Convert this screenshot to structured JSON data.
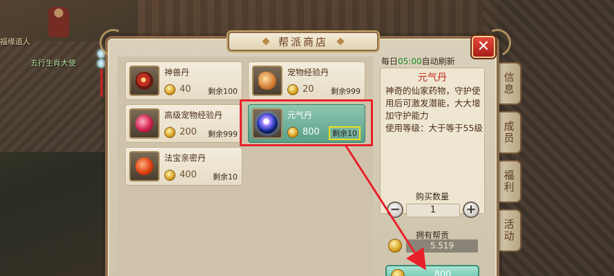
{
  "scene": {
    "npc_label_1": "福缘道人",
    "npc_label_2": "五行生肖大使"
  },
  "side_tabs": [
    "信息",
    "成员",
    "福利",
    "活动"
  ],
  "shop": {
    "title": "帮派商店",
    "close_label": "✕",
    "items": [
      {
        "name": "神兽丹",
        "price": "40",
        "stock": "剩余100",
        "icon": "shenshou-dan-icon"
      },
      {
        "name": "宠物经验丹",
        "price": "20",
        "stock": "剩余999",
        "icon": "pet-exp-pill-icon"
      },
      {
        "name": "高级宠物经验丹",
        "price": "200",
        "stock": "剩余999",
        "icon": "advanced-pet-exp-pill-icon"
      },
      {
        "name": "元气丹",
        "price": "800",
        "stock": "剩余10",
        "icon": "yuanqi-pill-icon",
        "selected": true
      },
      {
        "name": "法宝亲密丹",
        "price": "400",
        "stock": "剩余10",
        "icon": "fabao-intimacy-pill-icon"
      }
    ]
  },
  "detail": {
    "refresh_prefix": "每日",
    "refresh_time": "05:00",
    "refresh_suffix": "自动刷新",
    "item_name": "元气丹",
    "description": "神奇的仙家药物，守护使用后可激发潜能，大大增加守护能力",
    "level_req": "使用等级：大于等于55级",
    "qty_label": "购买数量",
    "qty_minus": "−",
    "qty_value": "1",
    "qty_plus": "+",
    "own_label": "拥有帮贡",
    "own_value": "5.519",
    "buy_price": "800"
  },
  "colors": {
    "highlight": "#e8202a",
    "selected_bg": "#5aa08a",
    "title_red": "#c02818",
    "refresh_green": "#1a8a2a"
  }
}
